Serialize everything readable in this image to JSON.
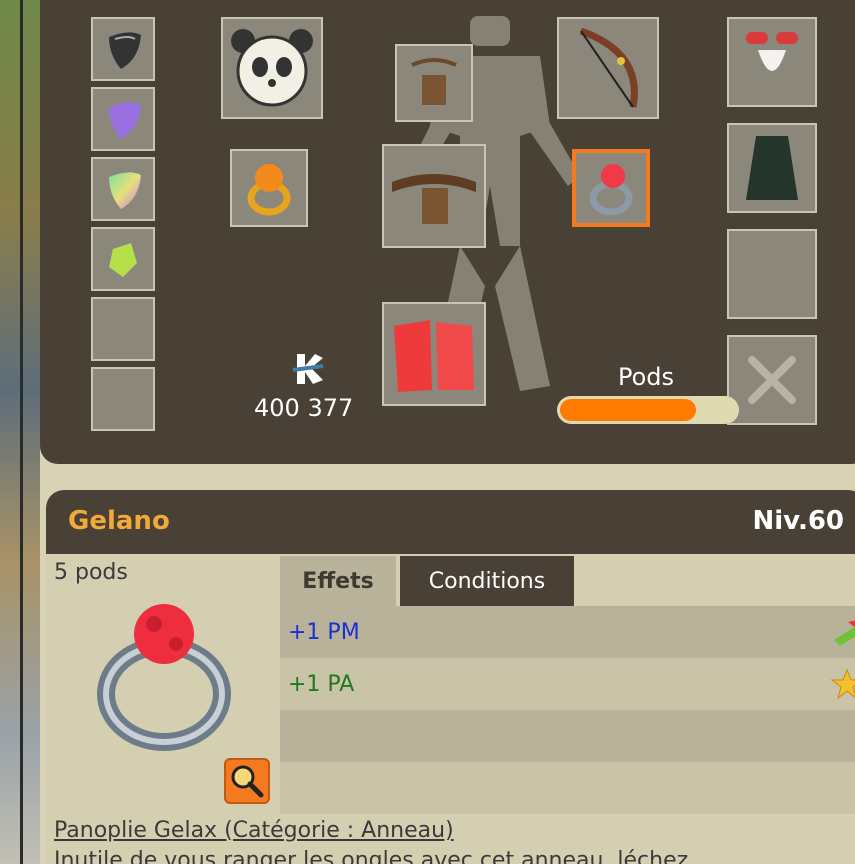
{
  "equipment": {
    "kamas": "400 377",
    "pods_label": "Pods",
    "pods_fill_fraction": 0.77,
    "selected_slot": "ring-right"
  },
  "item": {
    "name": "Gelano",
    "level": "Niv.60",
    "weight": "5 pods",
    "tabs": [
      {
        "label": "Effets",
        "active": true
      },
      {
        "label": "Conditions",
        "active": false
      }
    ],
    "effects": [
      {
        "text": "+1 PM",
        "color": "#1a2fd6",
        "icon": "boots-movement-icon"
      },
      {
        "text": "+1 PA",
        "color": "#1f7a1f",
        "icon": "star-action-icon"
      }
    ],
    "set_link": "Panoplie Gelax (Catégorie : Anneau)",
    "description": "Inutile de vous ranger les ongles avec cet anneau, léchez"
  },
  "colors": {
    "panel": "#4a4136",
    "accent_orange": "#f47a1f",
    "item_name": "#f3a93a",
    "slot_bg": "#8c877b"
  }
}
